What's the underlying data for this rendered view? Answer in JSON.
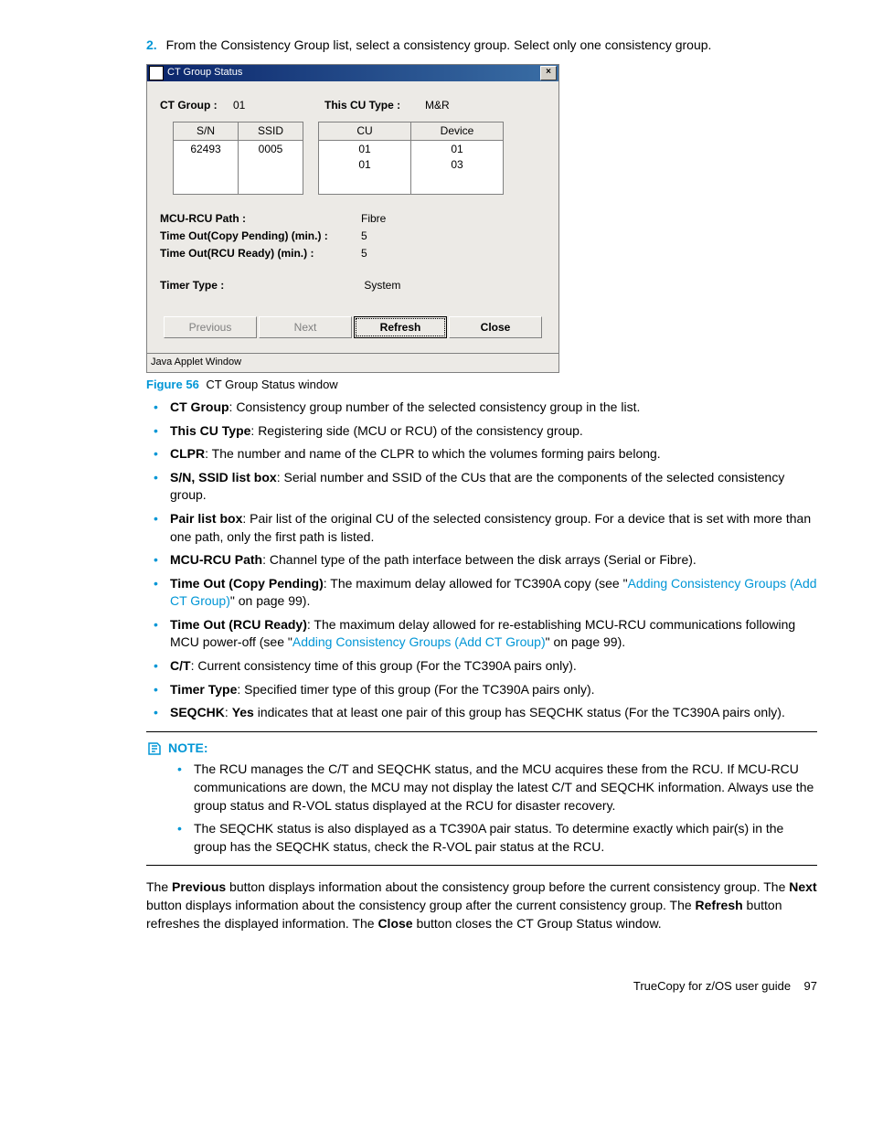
{
  "step": {
    "number": "2.",
    "text": "From the Consistency Group list, select a consistency group. Select only one consistency group."
  },
  "dialog": {
    "title": "CT Group Status",
    "close_x": "×",
    "ct_group_label": "CT Group :",
    "ct_group_value": "01",
    "cu_type_label": "This CU Type :",
    "cu_type_value": "M&R",
    "table1": {
      "headers": [
        "S/N",
        "SSID"
      ],
      "rows": [
        [
          "62493",
          "0005"
        ]
      ]
    },
    "table2": {
      "headers": [
        "CU",
        "Device"
      ],
      "rows": [
        [
          "01",
          "01"
        ],
        [
          "01",
          "03"
        ]
      ]
    },
    "info": [
      {
        "label": "MCU-RCU Path :",
        "value": "Fibre"
      },
      {
        "label": "Time Out(Copy Pending) (min.) :",
        "value": "5"
      },
      {
        "label": "Time Out(RCU Ready) (min.) :",
        "value": "5"
      }
    ],
    "timer_label": "Timer Type :",
    "timer_value": "System",
    "buttons": {
      "prev": "Previous",
      "next": "Next",
      "refresh": "Refresh",
      "close": "Close"
    },
    "statusbar": "Java Applet Window"
  },
  "figure": {
    "num": "Figure 56",
    "caption": "CT Group Status window"
  },
  "bullets": [
    {
      "b": "CT Group",
      "t": ": Consistency group number of the selected consistency group in the list."
    },
    {
      "b": "This CU Type",
      "t": ": Registering side (MCU or RCU) of the consistency group."
    },
    {
      "b": "CLPR",
      "t": ": The number and name of the CLPR to which the volumes forming pairs belong."
    },
    {
      "b": "S/N, SSID list box",
      "t": ": Serial number and SSID of the CUs that are the components of the selected consistency group."
    },
    {
      "b": "Pair list box",
      "t": ": Pair list of the original CU of the selected consistency group. For a device that is set with more than one path, only the first path is listed."
    },
    {
      "b": "MCU-RCU Path",
      "t": ": Channel type of the path interface between the disk arrays (Serial or Fibre)."
    },
    {
      "b": "Time Out (Copy Pending)",
      "t_pre": ": The maximum delay allowed for TC390A copy (see \"",
      "link": "Adding Consistency Groups (Add CT Group)",
      "t_post": "\" on page 99)."
    },
    {
      "b": "Time Out (RCU Ready)",
      "t_pre": ": The maximum delay allowed for re-establishing MCU-RCU communications following MCU power-off (see \"",
      "link": "Adding Consistency Groups (Add CT Group)",
      "t_post": "\" on page 99)."
    },
    {
      "b": "C/T",
      "t": ": Current consistency time of this group (For the TC390A pairs only)."
    },
    {
      "b": "Timer Type",
      "t": ": Specified timer type of this group (For the TC390A pairs only)."
    },
    {
      "b": "SEQCHK",
      "t_pre": ": ",
      "bold2": "Yes",
      "t_post2": " indicates that at least one pair of this group has SEQCHK status (For the TC390A pairs only)."
    }
  ],
  "note": {
    "label": "NOTE:",
    "items": [
      "The RCU manages the C/T and SEQCHK status, and the MCU acquires these from the RCU. If MCU-RCU communications are down, the MCU may not display the latest C/T and SEQCHK information. Always use the group status and R-VOL status displayed at the RCU for disaster recovery.",
      "The SEQCHK status is also displayed as a TC390A pair status. To determine exactly which pair(s) in the group has the SEQCHK status, check the R-VOL pair status at the RCU."
    ]
  },
  "para": {
    "p1a": "The ",
    "b1": "Previous",
    "p1b": " button displays information about the consistency group before the current consistency group. The ",
    "b2": "Next",
    "p2b": " button displays information about the consistency group after the current consistency group. The ",
    "b3": "Refresh",
    "p3b": " button refreshes the displayed information. The ",
    "b4": "Close",
    "p4b": " button closes the CT Group Status window."
  },
  "footer": {
    "title": "TrueCopy for z/OS user guide",
    "page": "97"
  }
}
